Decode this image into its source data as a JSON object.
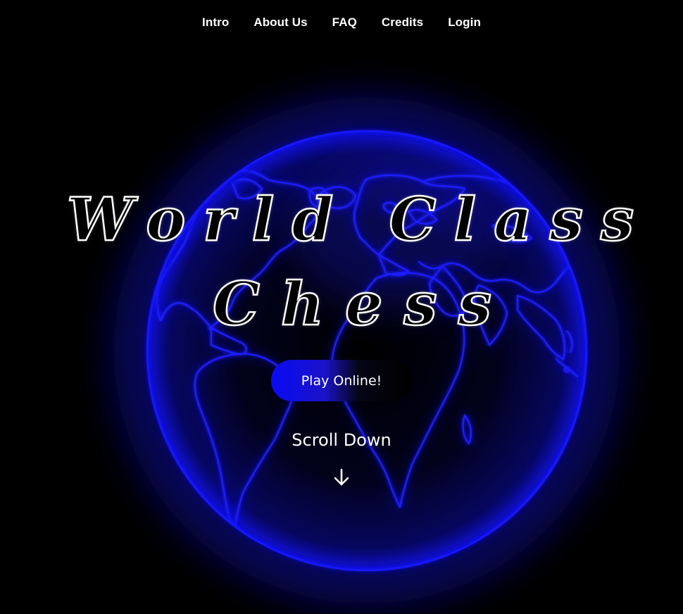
{
  "nav": {
    "items": [
      {
        "label": "Intro"
      },
      {
        "label": "About Us"
      },
      {
        "label": "FAQ"
      },
      {
        "label": "Credits"
      },
      {
        "label": "Login"
      }
    ]
  },
  "hero": {
    "title_line1": "World Class",
    "title_line2": "Chess",
    "play_button": "Play Online!",
    "scroll_label": "Scroll Down",
    "scroll_icon": "arrow-down-icon",
    "globe_icon": "neon-globe"
  },
  "colors": {
    "background": "#000000",
    "accent": "#1010ff",
    "text": "#ffffff"
  }
}
